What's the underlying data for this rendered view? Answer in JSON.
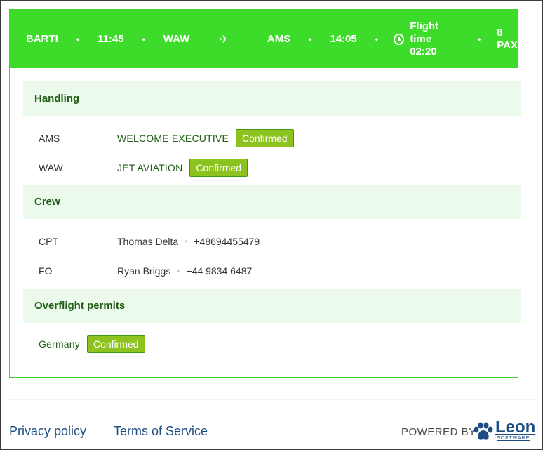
{
  "header": {
    "aircraft": "BARTI",
    "departure_time": "11:45",
    "origin": "WAW",
    "destination": "AMS",
    "arrival_time": "14:05",
    "flight_time_label": "Flight time",
    "flight_time_value": "02:20",
    "pax_count": "8",
    "pax_label": "PAX",
    "bullet": "•",
    "plane_glyph": "✈"
  },
  "handling": {
    "title": "Handling",
    "rows": [
      {
        "code": "AMS",
        "name": "WELCOME EXECUTIVE",
        "status": "Confirmed"
      },
      {
        "code": "WAW",
        "name": "JET AVIATION",
        "status": "Confirmed"
      }
    ]
  },
  "crew": {
    "title": "Crew",
    "rows": [
      {
        "role": "CPT",
        "name": "Thomas Delta",
        "phone": "+48694455479"
      },
      {
        "role": "FO",
        "name": "Ryan Briggs",
        "phone": "+44 9834 6487"
      }
    ]
  },
  "permits": {
    "title": "Overflight permits",
    "rows": [
      {
        "country": "Germany",
        "status": "Confirmed"
      }
    ]
  },
  "footer": {
    "privacy": "Privacy policy",
    "terms": "Terms of Service",
    "powered_by": "POWERED BY",
    "brand_name": "Leon",
    "brand_sub": "SOFTWARE"
  },
  "colors": {
    "header_green": "#3ddb2a",
    "section_bg": "#ebfaea",
    "badge_green": "#8dc31f",
    "link_blue": "#1f4e82"
  }
}
